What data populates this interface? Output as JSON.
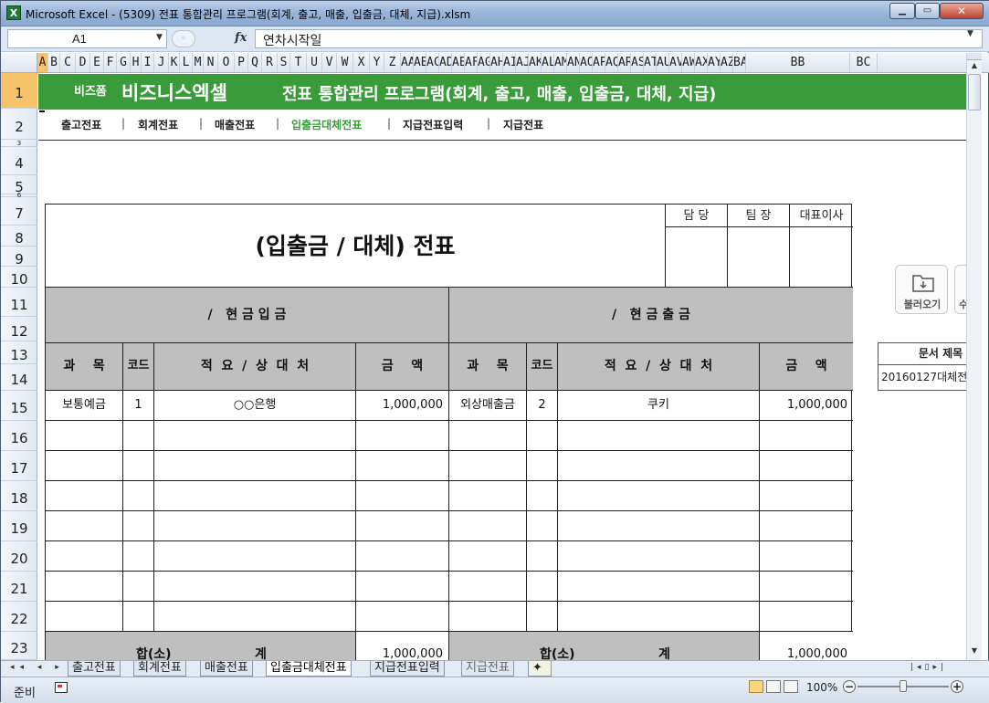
{
  "window": {
    "title": "Microsoft Excel - (5309) 전표 통합관리 프로그램(회계, 출고, 매출, 입출금, 대체, 지급).xlsm",
    "app_icon": "X"
  },
  "formula_bar": {
    "name_box": "A1",
    "fx": "fx",
    "content": "연차시작일"
  },
  "columns": [
    "A",
    "B",
    "C",
    "D",
    "E",
    "F",
    "G",
    "H",
    "I",
    "J",
    "K",
    "L",
    "M",
    "N",
    "O",
    "P",
    "Q",
    "R",
    "S",
    "T",
    "U",
    "V",
    "W",
    "X",
    "Y",
    "Z",
    "AA",
    "AB",
    "AC",
    "AD",
    "AE",
    "AF",
    "AG",
    "AH",
    "AI",
    "AJ",
    "AK",
    "AL",
    "AM",
    "AN",
    "AO",
    "AP",
    "AQ",
    "AR",
    "AS",
    "AT",
    "AU",
    "AV",
    "AW",
    "AX",
    "AY",
    "AZ",
    "BA",
    "BB",
    "BC"
  ],
  "rows": [
    "1",
    "2",
    "3",
    "4",
    "5",
    "6",
    "7",
    "8",
    "9",
    "10",
    "11",
    "12",
    "13",
    "14",
    "15",
    "16",
    "17",
    "18",
    "19",
    "20",
    "21",
    "22",
    "23"
  ],
  "banner": {
    "brand_small": "비즈폼",
    "brand_big": "비즈니스엑셀",
    "title": "전표 통합관리 프로그램(회계, 출고, 매출, 입출금, 대체, 지급)",
    "color": "#3a9b3a"
  },
  "nav": {
    "items": [
      "출고전표",
      "회계전표",
      "매출전표",
      "입출금대체전표",
      "지급전표입력",
      "지급전표"
    ],
    "separator": "|",
    "active_index": 3
  },
  "slip": {
    "title": "(입출금 / 대체) 전표",
    "approvals": [
      "담 당",
      "팀 장",
      "대표이사"
    ],
    "left_section": "/   현 금 입 금",
    "right_section": "/   현 금 출 금",
    "headers": {
      "subject": "과    목",
      "code": "코드",
      "summary": "적  요  /  상  대  처",
      "amount": "금    액"
    },
    "left_rows": [
      {
        "subject": "보통예금",
        "code": "1",
        "summary": "○○은행",
        "amount": "1,000,000"
      }
    ],
    "right_rows": [
      {
        "subject": "외상매출금",
        "code": "2",
        "summary": "쿠키",
        "amount": "1,000,000"
      }
    ],
    "subtotal_label_1": "합(소)",
    "subtotal_label_2": "계",
    "left_total": "1,000,000",
    "right_total": "1,000,000"
  },
  "side": {
    "load_label": "불러오기",
    "save_label": "수",
    "doc_title_header": "문서 제목",
    "doc_title_value": "20160127대체전"
  },
  "sheet_tabs": {
    "nav": "◂◂ ◂ ▸ ▸▸",
    "tabs": [
      "출고전표",
      "회계전표",
      "매출전표",
      "입출금대체전표",
      "지급전표입력",
      "지급전표"
    ],
    "active_index": 3
  },
  "status": {
    "ready": "준비",
    "zoom": "100%",
    "minus": "−",
    "plus": "+"
  }
}
